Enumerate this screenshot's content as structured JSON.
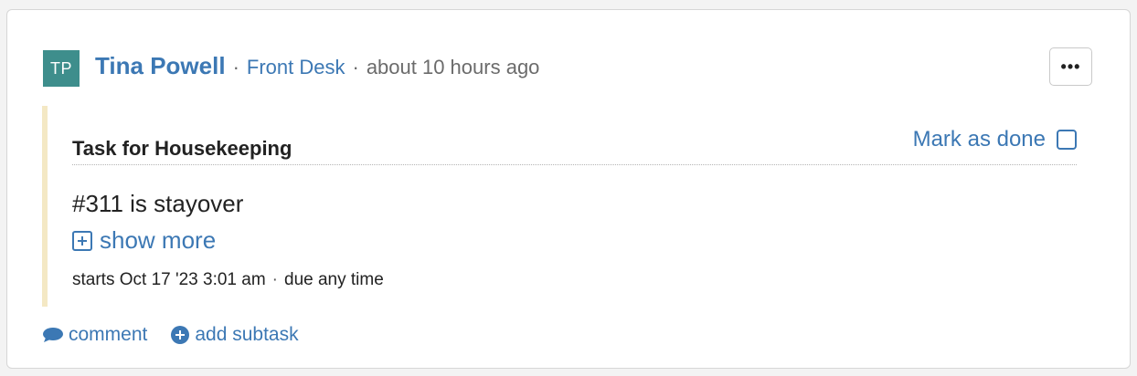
{
  "post": {
    "avatar_initials": "TP",
    "author_name": "Tina Powell",
    "separator": "·",
    "author_role": "Front Desk",
    "timestamp": "about 10 hours ago",
    "more_label": "•••"
  },
  "task": {
    "title": "Task for Housekeeping",
    "mark_done_label": "Mark as done",
    "body": "#311 is stayover",
    "show_more_label": "show more",
    "starts": "starts Oct 17 '23 3:01 am",
    "due": "due any time"
  },
  "actions": {
    "comment_label": "comment",
    "add_subtask_label": "add subtask"
  },
  "colors": {
    "accent": "#3c78b4",
    "avatar_bg": "#3e8e8c",
    "task_border": "#f4e8c4"
  },
  "icons": {
    "comment": "comment-icon",
    "add": "plus-circle-icon",
    "expand": "plus-square-icon",
    "checkbox": "checkbox-icon",
    "more": "ellipsis-icon"
  }
}
